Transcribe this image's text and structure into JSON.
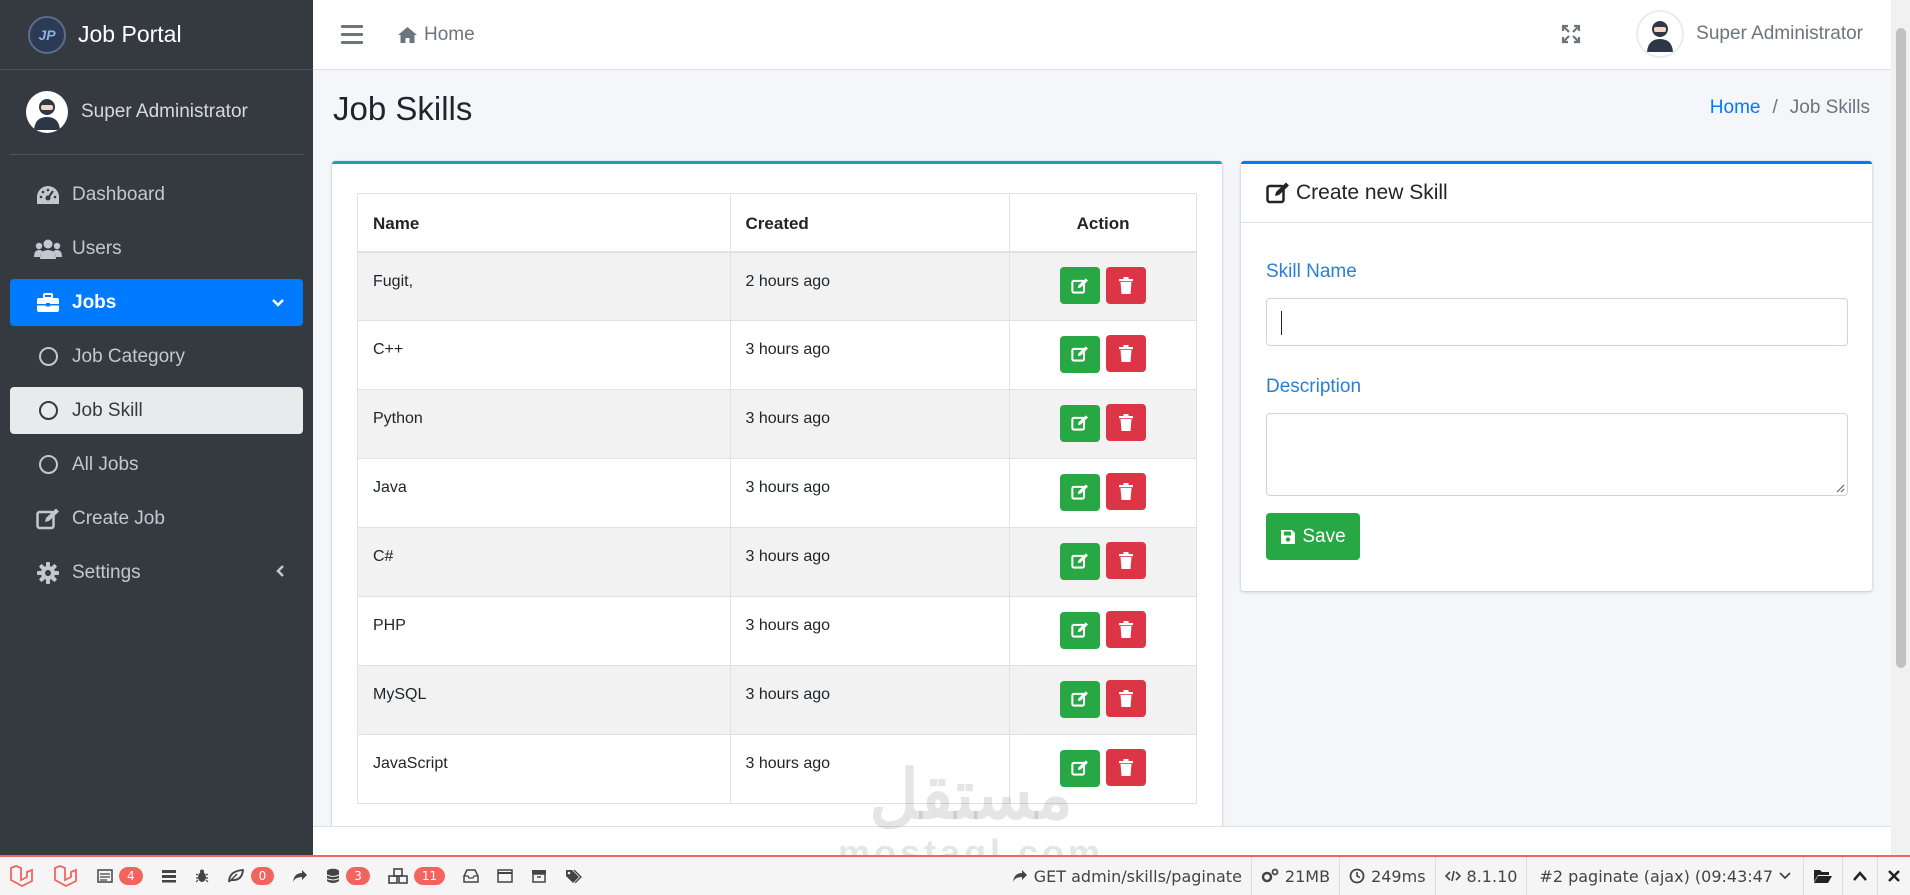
{
  "brand": {
    "name": "Job Portal",
    "logo_text": "JP"
  },
  "sidebar": {
    "user_name": "Super Administrator",
    "items": [
      {
        "label": "Dashboard",
        "icon": "tachometer-icon"
      },
      {
        "label": "Users",
        "icon": "users-icon"
      },
      {
        "label": "Jobs",
        "icon": "briefcase-icon",
        "active": true
      },
      {
        "label": "Job Category",
        "icon": "circle-icon"
      },
      {
        "label": "Job Skill",
        "icon": "circle-icon",
        "selected": true
      },
      {
        "label": "All Jobs",
        "icon": "circle-icon"
      },
      {
        "label": "Create Job",
        "icon": "edit-icon"
      },
      {
        "label": "Settings",
        "icon": "gear-icon"
      }
    ]
  },
  "topbar": {
    "home_label": "Home",
    "user_name": "Super Administrator"
  },
  "page": {
    "title": "Job Skills",
    "breadcrumb": {
      "home": "Home",
      "separator": "/",
      "current": "Job Skills"
    }
  },
  "table": {
    "headers": {
      "name": "Name",
      "created": "Created",
      "action": "Action"
    },
    "rows": [
      {
        "name": "Fugit,",
        "created": "2 hours ago"
      },
      {
        "name": "C++",
        "created": "3 hours ago"
      },
      {
        "name": "Python",
        "created": "3 hours ago"
      },
      {
        "name": "Java",
        "created": "3 hours ago"
      },
      {
        "name": "C#",
        "created": "3 hours ago"
      },
      {
        "name": "PHP",
        "created": "3 hours ago"
      },
      {
        "name": "MySQL",
        "created": "3 hours ago"
      },
      {
        "name": "JavaScript",
        "created": "3 hours ago"
      }
    ]
  },
  "form": {
    "title": "Create new Skill",
    "skill_name_label": "Skill Name",
    "skill_name_value": "",
    "description_label": "Description",
    "description_value": "",
    "save_label": "Save"
  },
  "debugbar": {
    "messages_count": "4",
    "exceptions_count": "0",
    "queries_count": "3",
    "models_count": "11",
    "route": "GET admin/skills/paginate",
    "memory": "21MB",
    "time": "249ms",
    "php_version": "8.1.10",
    "request": "#2 paginate (ajax) (09:43:47"
  },
  "watermark": {
    "arabic": "مستقل",
    "latin": "mostaql.com"
  },
  "colors": {
    "sidebar_bg": "#343a40",
    "active_blue": "#007bff",
    "edit_green": "#28a745",
    "delete_red": "#dc3545",
    "table_card_accent": "#17a2b8",
    "debug_accent": "#f4645f"
  }
}
